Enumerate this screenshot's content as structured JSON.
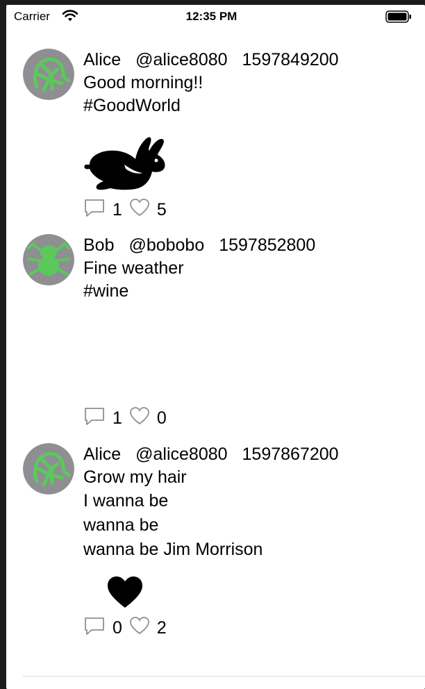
{
  "status_bar": {
    "carrier": "Carrier",
    "time": "12:35 PM"
  },
  "posts": [
    {
      "name": "Alice",
      "handle": "@alice8080",
      "timestamp": "1597849200",
      "lines": [
        "Good morning!!",
        "#GoodWorld"
      ],
      "image_icon": "rabbit-icon",
      "reply_count": "1",
      "like_count": "5",
      "avatar_icon": "turtle-avatar"
    },
    {
      "name": "Bob",
      "handle": "@bobobo",
      "timestamp": "1597852800",
      "lines": [
        "Fine weather",
        "#wine"
      ],
      "image_icon": "",
      "reply_count": "1",
      "like_count": "0",
      "avatar_icon": "spider-avatar"
    },
    {
      "name": "Alice",
      "handle": "@alice8080",
      "timestamp": "1597867200",
      "lines": [
        "Grow my hair",
        "I wanna be",
        "wanna be",
        "wanna be Jim Morrison"
      ],
      "image_icon": "heart-icon",
      "reply_count": "0",
      "like_count": "2",
      "avatar_icon": "turtle-avatar"
    }
  ],
  "colors": {
    "avatar_bg": "#8e8e93",
    "avatar_art": "#5cc85c",
    "icon_stroke": "#8e8e93"
  }
}
